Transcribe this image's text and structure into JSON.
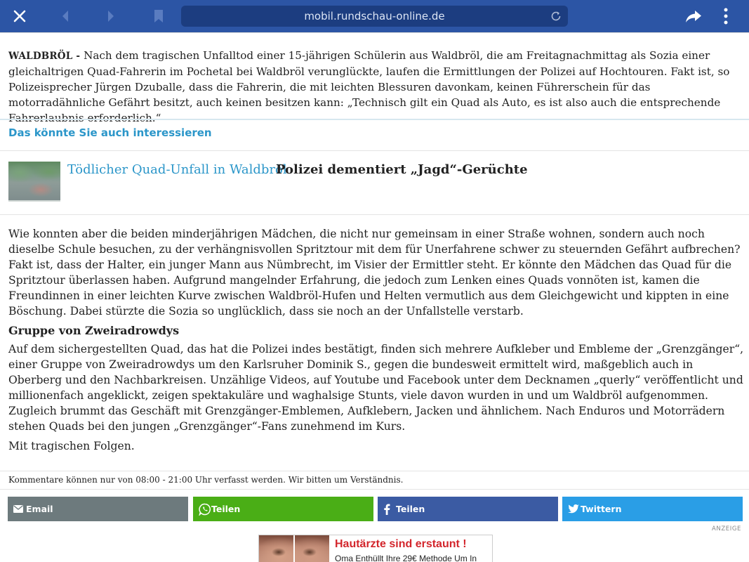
{
  "browser": {
    "url": "mobil.rundschau-online.de"
  },
  "intro": {
    "dateline": "WALDBRÖL - ",
    "text": "Nach dem tragischen Unfalltod einer 15-jährigen Schülerin aus Waldbröl, die am Freitagnachmittag als Sozia einer gleichaltrigen Quad-Fahrerin im Pochetal bei Waldbröl verunglückte, laufen die Ermittlungen der Polizei auf Hochtouren. Fakt ist, so Polizeisprecher Jürgen Dzuballe, dass die Fahrerin, die mit leichten Blessuren davonkam, keinen Führerschein für das motorradähnliche Gefährt besitzt, auch keinen besitzen kann: „Technisch gilt ein Quad als Auto, es ist also auch die entsprechende Fahrerlaubnis erforderlich.“"
  },
  "related": {
    "heading": "Das könnte Sie auch interessieren",
    "item": {
      "kicker": "Tödlicher Quad-Unfall in Waldbröl",
      "title": "Polizei dementiert „Jagd“-Gerüchte"
    }
  },
  "article": {
    "p1": "Wie konnten aber die beiden minderjährigen Mädchen, die nicht nur gemeinsam in einer Straße wohnen, sondern auch noch dieselbe Schule besuchen, zu der verhängnisvollen Spritztour mit dem für Unerfahrene schwer zu steuernden Gefährt aufbrechen? Fakt ist, dass der Halter, ein junger Mann aus Nümbrecht, im Visier der Ermittler steht. Er könnte den Mädchen das Quad für die Spritztour überlassen haben. Aufgrund mangelnder Erfahrung, die jedoch zum Lenken eines Quads vonnöten ist, kamen die Freundinnen in einer leichten Kurve zwischen Waldbröl-Hufen und Helten vermutlich aus dem Gleichgewicht und kippten in eine Böschung. Dabei stürzte die Sozia so unglücklich, dass sie noch an der Unfallstelle verstarb.",
    "subheading": "Gruppe von Zweiradrowdys",
    "p2": "Auf dem sichergestellten Quad, das hat die Polizei indes bestätigt, finden sich mehrere Aufkleber und Embleme der „Grenzgänger“, einer Gruppe von Zweiradrowdys um den Karlsruher Dominik S., gegen die bundesweit ermittelt wird, maßgeblich auch in Oberberg und den Nachbarkreisen. Unzählige Videos, auf Youtube und Facebook unter dem Decknamen „querly“ veröffentlicht und millionenfach angeklickt, zeigen spektakuläre und waghalsige Stunts, viele davon wurden in und um Waldbröl aufgenommen. Zugleich brummt das Geschäft mit Grenzgänger-Emblemen, Aufklebern, Jacken und ähnlichem. Nach Enduros und Motorrädern stehen Quads bei den jungen „Grenzgänger“-Fans zunehmend im Kurs.",
    "p3": "Mit tragischen Folgen."
  },
  "comments_note": "Kommentare können nur von 08:00 - 21:00 Uhr verfasst werden. Wir bitten um Verständnis.",
  "share": {
    "email": "Email",
    "whatsapp": "Teilen",
    "facebook": "Teilen",
    "twitter": "Twittern"
  },
  "ad": {
    "label": "ANZEIGE",
    "title": "Hautärzte sind erstaunt !",
    "subtitle": "Oma Enthüllt Ihre 29€ Methode Um In"
  },
  "colors": {
    "toolbar": "#2c55a5",
    "link_blue": "#2b96c9",
    "email": "#6d7a7d",
    "whatsapp": "#4aae16",
    "facebook": "#3b5ba3",
    "twitter": "#2a9ee6",
    "ad_red": "#d3262c"
  }
}
